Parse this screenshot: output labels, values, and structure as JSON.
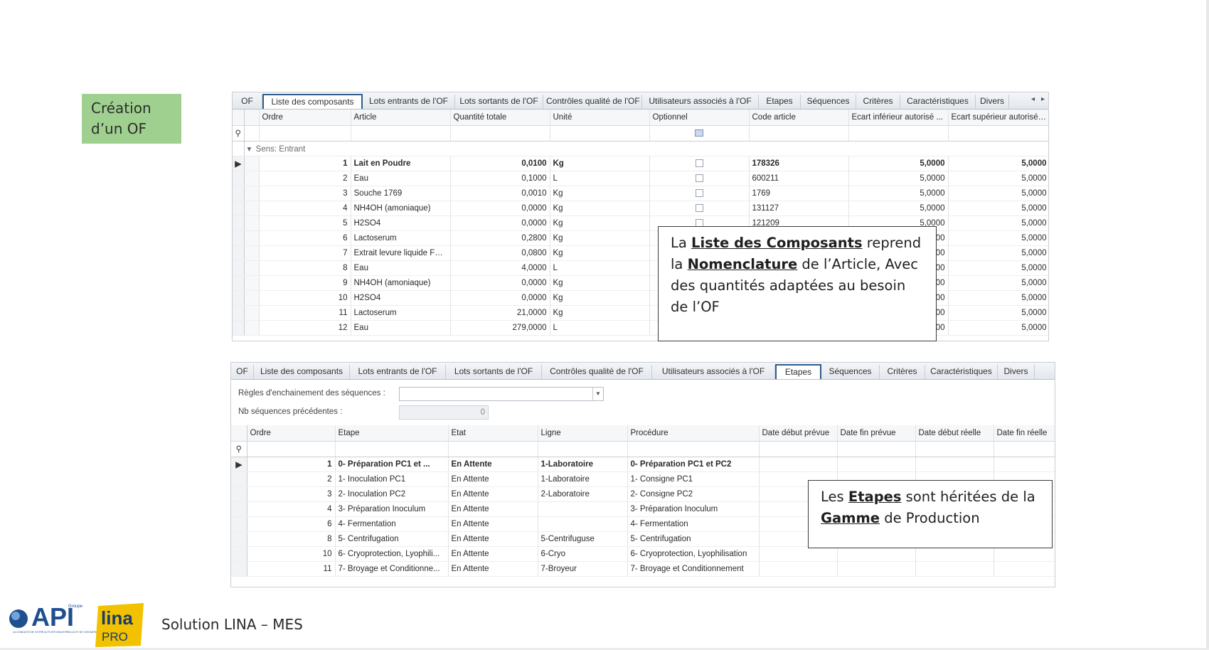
{
  "slide": {
    "title": "Création d’un OF",
    "footer": "Solution LINA – MES",
    "logo_api": "API",
    "logo_groupe": "Groupe",
    "logo_tagline": "LA CONDUITE DE VOTRE ACTIVITÉ INDUSTRIELLE ET DE VOS BÂTIMENTS",
    "logo_lina": "lina",
    "logo_pro": "PRO"
  },
  "tabs": [
    "OF",
    "Liste des composants",
    "Lots entrants de l'OF",
    "Lots sortants de l'OF",
    "Contrôles qualité de l'OF",
    "Utilisateurs associés à l'OF",
    "Etapes",
    "Séquences",
    "Critères",
    "Caractéristiques",
    "Divers"
  ],
  "panel1": {
    "active_tab": "Liste des composants",
    "columns": [
      "Ordre",
      "Article",
      "Quantité totale",
      "Unité",
      "Optionnel",
      "Code article",
      "Ecart inférieur autorisé ...",
      "Ecart supérieur autorisé ..."
    ],
    "group_label": "Sens: Entrant",
    "rows": [
      [
        "1",
        "Lait en Poudre",
        "0,0100",
        "Kg",
        "",
        "178326",
        "5,0000",
        "5,0000"
      ],
      [
        "2",
        "Eau",
        "0,1000",
        "L",
        "",
        "600211",
        "5,0000",
        "5,0000"
      ],
      [
        "3",
        "Souche 1769",
        "0,0010",
        "Kg",
        "",
        "1769",
        "5,0000",
        "5,0000"
      ],
      [
        "4",
        "NH4OH (amoniaque)",
        "0,0000",
        "Kg",
        "",
        "131127",
        "5,0000",
        "5,0000"
      ],
      [
        "5",
        "H2SO4",
        "0,0000",
        "Kg",
        "",
        "121209",
        "5,0000",
        "5,0000"
      ],
      [
        "6",
        "Lactoserum",
        "0,2800",
        "Kg",
        "",
        "",
        "00",
        "5,0000"
      ],
      [
        "7",
        "Extrait levure liquide FN...",
        "0,0800",
        "Kg",
        "",
        "",
        "00",
        "5,0000"
      ],
      [
        "8",
        "Eau",
        "4,0000",
        "L",
        "",
        "",
        "00",
        "5,0000"
      ],
      [
        "9",
        "NH4OH (amoniaque)",
        "0,0000",
        "Kg",
        "",
        "",
        "00",
        "5,0000"
      ],
      [
        "10",
        "H2SO4",
        "0,0000",
        "Kg",
        "",
        "",
        "00",
        "5,0000"
      ],
      [
        "11",
        "Lactoserum",
        "21,0000",
        "Kg",
        "",
        "",
        "00",
        "5,0000"
      ],
      [
        "12",
        "Eau",
        "279,0000",
        "L",
        "",
        "",
        "00",
        "5,0000"
      ]
    ]
  },
  "panel2": {
    "active_tab": "Etapes",
    "rule_label": "Règles d'enchainement des séquences :",
    "rule_value": "",
    "prev_label": "Nb séquences précédentes :",
    "prev_value": "0",
    "columns": [
      "Ordre",
      "Etape",
      "Etat",
      "Ligne",
      "Procédure",
      "Date début prévue",
      "Date fin prévue",
      "Date début réelle",
      "Date fin réelle"
    ],
    "rows": [
      [
        "1",
        "0- Préparation PC1 et ...",
        "En Attente",
        "1-Laboratoire",
        "0- Préparation PC1 et PC2",
        "",
        "",
        "",
        ""
      ],
      [
        "2",
        "1- Inoculation PC1",
        "En Attente",
        "1-Laboratoire",
        "1- Consigne PC1",
        "",
        "",
        "",
        ""
      ],
      [
        "3",
        "2- Inoculation PC2",
        "En Attente",
        "2-Laboratoire",
        "2- Consigne PC2",
        "",
        "",
        "",
        ""
      ],
      [
        "4",
        "3- Préparation Inoculum",
        "En Attente",
        "",
        "3- Préparation Inoculum",
        "",
        "",
        "",
        ""
      ],
      [
        "6",
        "4- Fermentation",
        "En Attente",
        "",
        "4- Fermentation",
        "",
        "",
        "",
        ""
      ],
      [
        "8",
        "5- Centrifugation",
        "En Attente",
        "5-Centrifuguse",
        "5- Centrifugation",
        "",
        "",
        "",
        ""
      ],
      [
        "10",
        "6- Cryoprotection, Lyophili...",
        "En Attente",
        "6-Cryo",
        "6- Cryoprotection, Lyophilisation",
        "",
        "",
        "",
        ""
      ],
      [
        "11",
        "7- Broyage et Conditionne...",
        "En Attente",
        "7-Broyeur",
        "7- Broyage et Conditionnement",
        "",
        "",
        "",
        ""
      ]
    ]
  },
  "callout1": {
    "t1": "La ",
    "b1": "Liste des Composants",
    "t2": " reprend la ",
    "b2": "Nomenclature",
    "t3": " de l’Article, Avec des quantités adaptées au besoin de l’OF"
  },
  "callout2": {
    "t1": "Les ",
    "b1": "Etapes",
    "t2": " sont héritées de la ",
    "b2": "Gamme",
    "t3": " de Production"
  },
  "colors": {
    "title_bg": "#9fd08f",
    "tab_highlight": "#2e5d8f",
    "logo_blue": "#1f4f8f",
    "logo_yellow": "#f2c200"
  }
}
